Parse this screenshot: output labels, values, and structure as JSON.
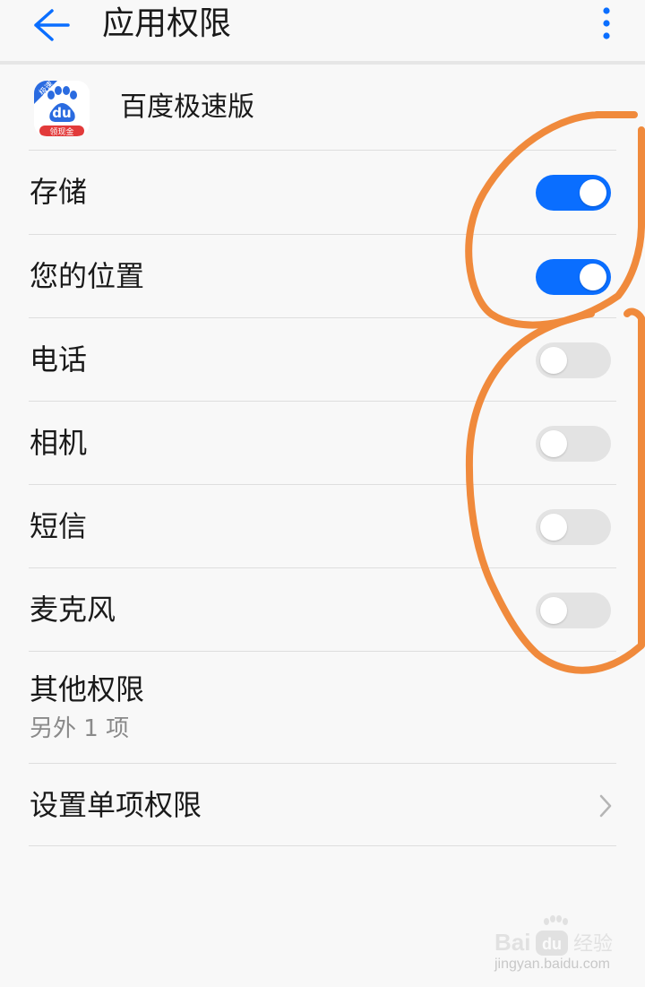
{
  "header": {
    "back_icon": "arrow-left-icon",
    "title": "应用权限",
    "more_icon": "more-vertical-icon"
  },
  "app": {
    "name": "百度极速版",
    "icon": "baidu-paw-icon",
    "icon_badge_top": "极速",
    "icon_text": "du",
    "icon_badge_bottom": "领现金"
  },
  "permissions": [
    {
      "label": "存储",
      "enabled": true
    },
    {
      "label": "您的位置",
      "enabled": true
    },
    {
      "label": "电话",
      "enabled": false
    },
    {
      "label": "相机",
      "enabled": false
    },
    {
      "label": "短信",
      "enabled": false
    },
    {
      "label": "麦克风",
      "enabled": false
    }
  ],
  "other_permissions": {
    "title": "其他权限",
    "subtitle": "另外 1 项"
  },
  "single_permission": {
    "label": "设置单项权限",
    "chevron_icon": "chevron-right-icon"
  },
  "watermark": {
    "logo_text": "Bai du 经验",
    "url": "jingyan.baidu.com"
  },
  "colors": {
    "accent": "#0a6eff",
    "toggle_off": "#e3e3e3",
    "annotation": "#f08a3c"
  }
}
